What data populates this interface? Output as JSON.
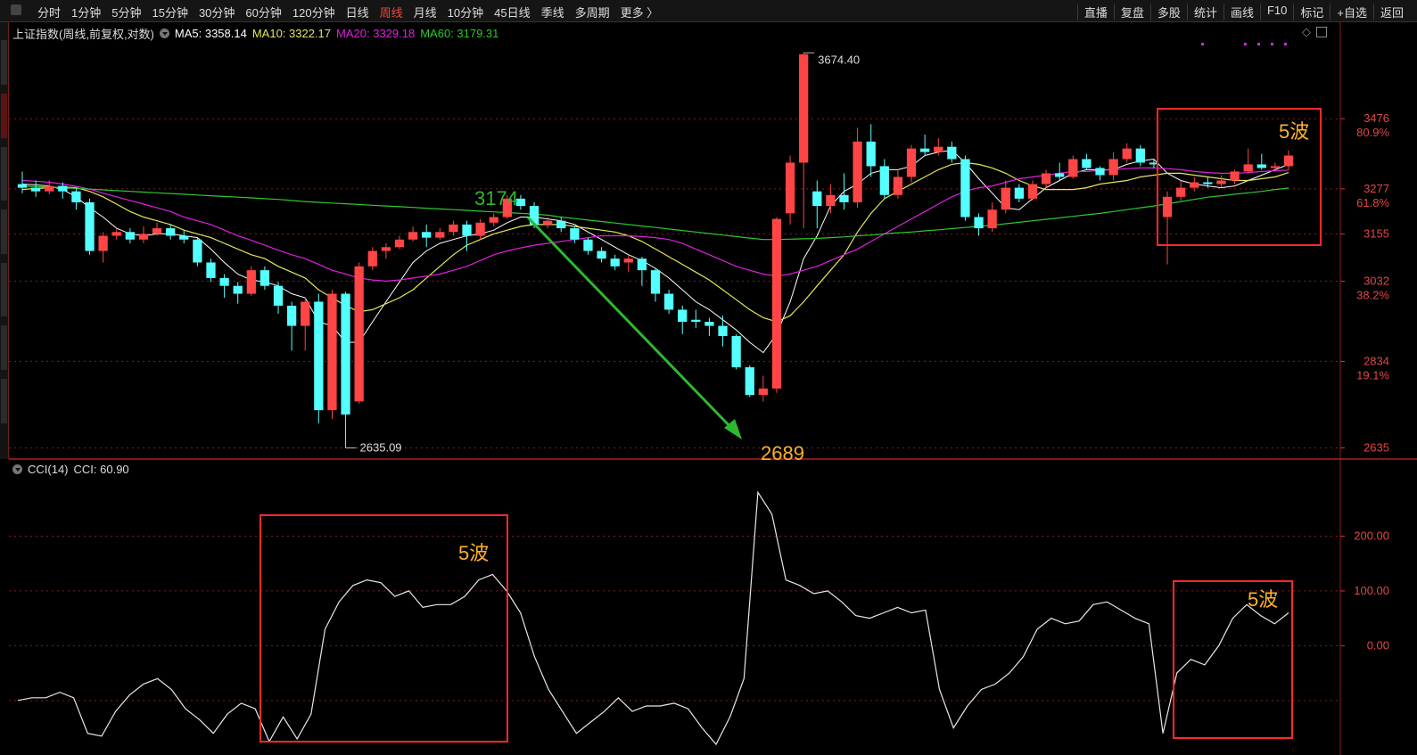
{
  "toolbar": {
    "periods": [
      "分时",
      "1分钟",
      "5分钟",
      "15分钟",
      "30分钟",
      "60分钟",
      "120分钟",
      "日线",
      "周线",
      "月线",
      "10分钟",
      "45日线",
      "季线",
      "多周期",
      "更多 〉"
    ],
    "active_period": "周线",
    "right_buttons": [
      "直播",
      "复盘",
      "多股",
      "统计",
      "画线",
      "F10",
      "标记",
      "+自选",
      "返回"
    ]
  },
  "main_header": {
    "title": "上证指数(周线,前复权,对数)",
    "ma5": "MA5: 3358.14",
    "ma10": "MA10: 3322.17",
    "ma20": "MA20: 3329.18",
    "ma60": "MA60: 3179.31"
  },
  "cci_header": {
    "name": "CCI(14)",
    "value": "CCI: 60.90"
  },
  "colors": {
    "up": "#ff4545",
    "down": "#54ffff",
    "ma5": "#ffffff",
    "ma10": "#e6e65c",
    "ma20": "#e020e0",
    "ma60": "#2ec82e",
    "annotation_orange": "#ffb02e",
    "annotation_green": "#2fb82f",
    "box_red": "#ff2a2a",
    "grid_red": "#8a1d1d"
  },
  "chart_data": [
    {
      "type": "candlestick",
      "title": "上证指数(周线,前复权,对数)",
      "scale": "log",
      "right_axis_ticks": [
        {
          "price": "3476",
          "pct": "80.9%"
        },
        {
          "price": "3277",
          "pct": "61.8%"
        },
        {
          "price": "3155",
          "pct": ""
        },
        {
          "price": "3032",
          "pct": "38.2%"
        },
        {
          "price": "2834",
          "pct": "19.1%"
        },
        {
          "price": "2635",
          "pct": ""
        }
      ],
      "ylim": [
        2630,
        3700
      ],
      "candles": [
        [
          3290,
          3280,
          3325,
          3265
        ],
        [
          3280,
          3270,
          3300,
          3255
        ],
        [
          3270,
          3285,
          3300,
          3262
        ],
        [
          3285,
          3270,
          3295,
          3250
        ],
        [
          3270,
          3240,
          3278,
          3220
        ],
        [
          3240,
          3110,
          3250,
          3100
        ],
        [
          3110,
          3150,
          3160,
          3080
        ],
        [
          3150,
          3160,
          3170,
          3140
        ],
        [
          3160,
          3140,
          3170,
          3130
        ],
        [
          3140,
          3155,
          3175,
          3130
        ],
        [
          3155,
          3170,
          3185,
          3150
        ],
        [
          3170,
          3150,
          3180,
          3140
        ],
        [
          3150,
          3140,
          3165,
          3130
        ],
        [
          3140,
          3080,
          3145,
          3070
        ],
        [
          3080,
          3040,
          3090,
          3030
        ],
        [
          3040,
          3020,
          3050,
          2990
        ],
        [
          3020,
          3000,
          3030,
          2975
        ],
        [
          3000,
          3060,
          3070,
          2995
        ],
        [
          3060,
          3020,
          3070,
          3010
        ],
        [
          3020,
          2970,
          3030,
          2950
        ],
        [
          2970,
          2920,
          2980,
          2860
        ],
        [
          2920,
          2980,
          2990,
          2860
        ],
        [
          2980,
          2720,
          3000,
          2690
        ],
        [
          2720,
          3000,
          3010,
          2700
        ],
        [
          3000,
          2710,
          3005,
          2635
        ],
        [
          2740,
          3070,
          3080,
          2735
        ],
        [
          3070,
          3110,
          3120,
          3060
        ],
        [
          3110,
          3120,
          3130,
          3090
        ],
        [
          3120,
          3140,
          3150,
          3115
        ],
        [
          3140,
          3160,
          3175,
          3135
        ],
        [
          3160,
          3145,
          3180,
          3120
        ],
        [
          3145,
          3160,
          3170,
          3140
        ],
        [
          3160,
          3180,
          3190,
          3150
        ],
        [
          3180,
          3150,
          3190,
          3110
        ],
        [
          3150,
          3185,
          3195,
          3140
        ],
        [
          3185,
          3200,
          3210,
          3175
        ],
        [
          3200,
          3250,
          3260,
          3195
        ],
        [
          3250,
          3230,
          3260,
          3220
        ],
        [
          3230,
          3180,
          3240,
          3170
        ],
        [
          3180,
          3190,
          3200,
          3170
        ],
        [
          3190,
          3170,
          3200,
          3160
        ],
        [
          3170,
          3140,
          3175,
          3130
        ],
        [
          3140,
          3110,
          3145,
          3100
        ],
        [
          3110,
          3090,
          3120,
          3080
        ],
        [
          3090,
          3070,
          3100,
          3060
        ],
        [
          3080,
          3090,
          3100,
          3055
        ],
        [
          3090,
          3060,
          3095,
          3020
        ],
        [
          3060,
          3000,
          3065,
          2980
        ],
        [
          3000,
          2960,
          3010,
          2950
        ],
        [
          2960,
          2930,
          2970,
          2900
        ],
        [
          2935,
          2930,
          2960,
          2915
        ],
        [
          2930,
          2920,
          2940,
          2895
        ],
        [
          2920,
          2895,
          2945,
          2870
        ],
        [
          2895,
          2820,
          2900,
          2815
        ],
        [
          2820,
          2755,
          2825,
          2750
        ],
        [
          2755,
          2770,
          2800,
          2740
        ],
        [
          2770,
          3195,
          3200,
          2760
        ],
        [
          3210,
          3350,
          3370,
          3180
        ],
        [
          3350,
          3670,
          3674.4,
          3170
        ],
        [
          3270,
          3230,
          3300,
          3170
        ],
        [
          3230,
          3260,
          3290,
          3210
        ],
        [
          3260,
          3240,
          3320,
          3220
        ],
        [
          3240,
          3410,
          3450,
          3225
        ],
        [
          3410,
          3340,
          3460,
          3310
        ],
        [
          3340,
          3260,
          3360,
          3250
        ],
        [
          3260,
          3310,
          3330,
          3250
        ],
        [
          3310,
          3390,
          3400,
          3295
        ],
        [
          3390,
          3380,
          3430,
          3370
        ],
        [
          3380,
          3395,
          3420,
          3370
        ],
        [
          3395,
          3360,
          3410,
          3350
        ],
        [
          3360,
          3200,
          3370,
          3190
        ],
        [
          3200,
          3170,
          3210,
          3150
        ],
        [
          3170,
          3220,
          3240,
          3160
        ],
        [
          3220,
          3280,
          3300,
          3210
        ],
        [
          3280,
          3250,
          3290,
          3240
        ],
        [
          3250,
          3290,
          3300,
          3245
        ],
        [
          3290,
          3320,
          3330,
          3280
        ],
        [
          3320,
          3310,
          3350,
          3300
        ],
        [
          3310,
          3360,
          3370,
          3305
        ],
        [
          3360,
          3335,
          3375,
          3330
        ],
        [
          3335,
          3315,
          3340,
          3300
        ],
        [
          3315,
          3360,
          3380,
          3300
        ],
        [
          3360,
          3390,
          3405,
          3350
        ],
        [
          3390,
          3350,
          3400,
          3340
        ],
        [
          3350,
          3345,
          3360,
          3335
        ],
        [
          3200,
          3255,
          3270,
          3075
        ],
        [
          3255,
          3280,
          3300,
          3245
        ],
        [
          3280,
          3295,
          3310,
          3270
        ],
        [
          3295,
          3290,
          3310,
          3280
        ],
        [
          3290,
          3300,
          3315,
          3280
        ],
        [
          3300,
          3325,
          3330,
          3290
        ],
        [
          3325,
          3345,
          3390,
          3320
        ],
        [
          3345,
          3335,
          3375,
          3330
        ],
        [
          3335,
          3340,
          3350,
          3325
        ],
        [
          3340,
          3370,
          3385,
          3330
        ]
      ],
      "ma_lines": {
        "MA5": [
          3290,
          3288,
          3285,
          3275,
          3255,
          3225,
          3200,
          3170,
          3155,
          3150,
          3155,
          3155,
          3150,
          3145,
          3115,
          3080,
          3050,
          3035,
          3030,
          3020,
          3000,
          2990,
          2930,
          2920,
          2880,
          2880,
          2930,
          2980,
          3030,
          3080,
          3110,
          3130,
          3140,
          3150,
          3155,
          3165,
          3185,
          3200,
          3200,
          3195,
          3190,
          3180,
          3160,
          3140,
          3120,
          3100,
          3085,
          3065,
          3040,
          3010,
          2980,
          2960,
          2935,
          2910,
          2880,
          2855,
          2900,
          2980,
          3090,
          3150,
          3230,
          3270,
          3290,
          3320,
          3330,
          3330,
          3340,
          3370,
          3380,
          3385,
          3350,
          3305,
          3265,
          3225,
          3220,
          3250,
          3280,
          3300,
          3320,
          3330,
          3330,
          3330,
          3345,
          3355,
          3360,
          3320,
          3300,
          3290,
          3285,
          3280,
          3285,
          3300,
          3315,
          3330,
          3345
        ],
        "MA10": [
          3275,
          3278,
          3280,
          3282,
          3280,
          3270,
          3255,
          3235,
          3215,
          3200,
          3190,
          3180,
          3165,
          3155,
          3145,
          3130,
          3115,
          3100,
          3090,
          3070,
          3055,
          3040,
          3010,
          2990,
          2970,
          2955,
          2960,
          2975,
          2990,
          3010,
          3040,
          3070,
          3100,
          3125,
          3140,
          3155,
          3165,
          3175,
          3180,
          3180,
          3180,
          3175,
          3170,
          3165,
          3160,
          3150,
          3135,
          3115,
          3095,
          3075,
          3055,
          3035,
          3010,
          2985,
          2960,
          2940,
          2930,
          2945,
          2980,
          3020,
          3060,
          3100,
          3160,
          3210,
          3250,
          3270,
          3290,
          3310,
          3330,
          3345,
          3350,
          3345,
          3335,
          3320,
          3300,
          3285,
          3275,
          3275,
          3275,
          3280,
          3290,
          3295,
          3300,
          3310,
          3315,
          3320,
          3320,
          3315,
          3310,
          3305,
          3300,
          3300,
          3305,
          3310,
          3322
        ],
        "MA20": [
          3300,
          3298,
          3295,
          3290,
          3284,
          3276,
          3265,
          3255,
          3245,
          3235,
          3225,
          3215,
          3200,
          3190,
          3180,
          3165,
          3150,
          3138,
          3125,
          3112,
          3100,
          3090,
          3075,
          3060,
          3050,
          3040,
          3035,
          3032,
          3035,
          3040,
          3045,
          3050,
          3060,
          3070,
          3085,
          3100,
          3110,
          3118,
          3125,
          3130,
          3135,
          3140,
          3145,
          3150,
          3150,
          3150,
          3148,
          3145,
          3140,
          3130,
          3115,
          3100,
          3085,
          3070,
          3060,
          3050,
          3045,
          3050,
          3060,
          3070,
          3085,
          3100,
          3115,
          3135,
          3155,
          3175,
          3195,
          3215,
          3235,
          3255,
          3270,
          3280,
          3285,
          3295,
          3305,
          3310,
          3315,
          3320,
          3325,
          3325,
          3328,
          3330,
          3333,
          3335,
          3335,
          3333,
          3330,
          3325,
          3322,
          3320,
          3320,
          3322,
          3325,
          3327,
          3329
        ],
        "MA60": [
          3285,
          3283,
          3282,
          3280,
          3278,
          3276,
          3274,
          3272,
          3270,
          3268,
          3266,
          3264,
          3262,
          3260,
          3258,
          3256,
          3254,
          3252,
          3250,
          3248,
          3245,
          3242,
          3240,
          3238,
          3236,
          3234,
          3232,
          3230,
          3228,
          3226,
          3224,
          3222,
          3220,
          3218,
          3216,
          3214,
          3212,
          3210,
          3208,
          3205,
          3200,
          3196,
          3192,
          3188,
          3184,
          3180,
          3176,
          3172,
          3168,
          3164,
          3160,
          3156,
          3152,
          3148,
          3144,
          3140,
          3140,
          3141,
          3142,
          3143,
          3145,
          3147,
          3150,
          3152,
          3155,
          3158,
          3160,
          3163,
          3166,
          3169,
          3172,
          3175,
          3178,
          3182,
          3186,
          3190,
          3194,
          3198,
          3202,
          3206,
          3210,
          3215,
          3220,
          3225,
          3230,
          3236,
          3242,
          3248,
          3254,
          3258,
          3262,
          3266,
          3270,
          3275,
          3279
        ]
      },
      "annotations": {
        "hi_label": "3674.40",
        "lo_label": "2635.09",
        "peak_text": "3174",
        "trough_text": "2689",
        "wave_text": "5波"
      }
    },
    {
      "type": "line",
      "title": "CCI(14)",
      "series": [
        {
          "name": "CCI(14)",
          "values": [
            -100,
            -95,
            -95,
            -85,
            -95,
            -160,
            -165,
            -120,
            -90,
            -70,
            -60,
            -80,
            -115,
            -135,
            -160,
            -125,
            -105,
            -115,
            -175,
            -130,
            -170,
            -125,
            30,
            80,
            110,
            120,
            115,
            90,
            100,
            70,
            75,
            75,
            90,
            120,
            130,
            100,
            60,
            -20,
            -80,
            -120,
            -160,
            -140,
            -120,
            -95,
            -120,
            -110,
            -110,
            -105,
            -115,
            -150,
            -180,
            -130,
            -60,
            280,
            240,
            120,
            110,
            95,
            100,
            80,
            55,
            50,
            60,
            70,
            60,
            65,
            -80,
            -150,
            -110,
            -80,
            -70,
            -50,
            -20,
            30,
            50,
            40,
            45,
            75,
            80,
            65,
            50,
            40,
            -160,
            -50,
            -25,
            -35,
            0,
            50,
            75,
            55,
            40,
            60
          ]
        }
      ],
      "y_ticks": [
        "200.00",
        "100.00",
        "0.00"
      ],
      "ylim": [
        -180,
        300
      ],
      "wave_text": "5波"
    }
  ]
}
